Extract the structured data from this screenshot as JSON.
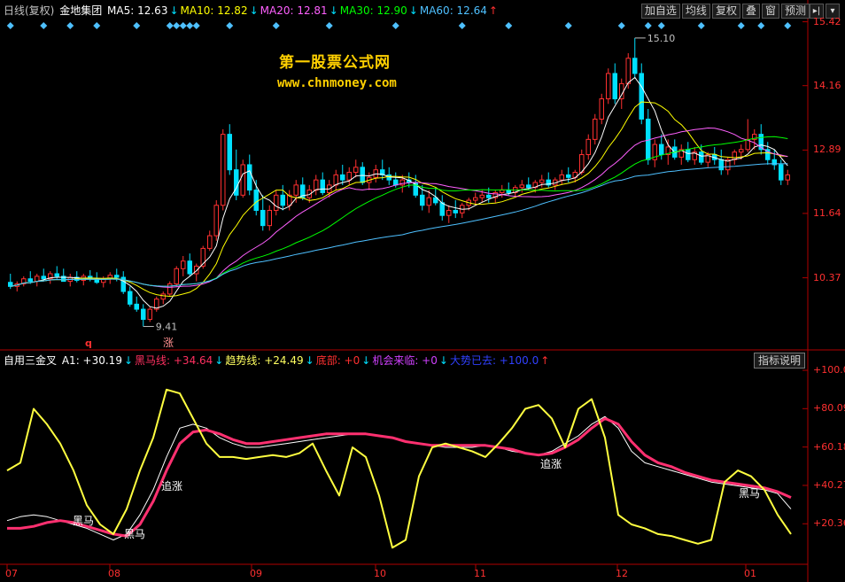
{
  "header": {
    "period": "日线(复权)",
    "stock_name": "金地集团",
    "ma": [
      {
        "label": "MA5:",
        "value": "12.63",
        "arrow": "↓",
        "color": "#ffffff"
      },
      {
        "label": "MA10:",
        "value": "12.82",
        "arrow": "↓",
        "color": "#ffff00"
      },
      {
        "label": "MA20:",
        "value": "12.81",
        "arrow": "↓",
        "color": "#ff60ff"
      },
      {
        "label": "MA30:",
        "value": "12.90",
        "arrow": "↓",
        "color": "#00ff00"
      },
      {
        "label": "MA60:",
        "value": "12.64",
        "arrow": "↑",
        "color": "#4ec0ff"
      }
    ]
  },
  "toolbar": {
    "buttons": [
      "加自选",
      "均线",
      "复权",
      "叠",
      "窗",
      "预测"
    ],
    "nav_icon": "collapse-arrow-icon",
    "dropdown_icon": "dropdown-icon"
  },
  "watermark": {
    "title": "第一股票公式网",
    "url": "www.chnmoney.com"
  },
  "indicator": {
    "name": "自用三金叉",
    "items": [
      {
        "label": "A1:",
        "value": "+30.19",
        "arrow": "↓",
        "color": "#ffffff"
      },
      {
        "label": "黑马线:",
        "value": "+34.64",
        "arrow": "↓",
        "color": "#ff3060"
      },
      {
        "label": "趋势线:",
        "value": "+24.49",
        "arrow": "↓",
        "color": "#ffff60"
      },
      {
        "label": "底部:",
        "value": "+0",
        "arrow": "↓",
        "color": "#ff3030"
      },
      {
        "label": "机会来临:",
        "value": "+0",
        "arrow": "↓",
        "color": "#d040ff"
      },
      {
        "label": "大势已去:",
        "value": "+100.0",
        "arrow": "↑",
        "color": "#3040ff"
      }
    ],
    "help_button": "指标说明"
  },
  "colors": {
    "up": "#ff3030",
    "down": "#00e0ff",
    "axis": "#b00000"
  },
  "chart_data": [
    {
      "type": "candlestick",
      "ylim": [
        9.0,
        15.5
      ],
      "y_ticks": [
        15.42,
        14.16,
        12.89,
        11.64,
        10.37
      ],
      "x_tick_labels": [
        "07",
        "08",
        "09",
        "10",
        "11",
        "12",
        "01"
      ],
      "annotations": [
        {
          "label": "15.10",
          "note": "period high"
        },
        {
          "label": "9.41",
          "note": "period low"
        }
      ],
      "markers": [
        "q",
        "涨"
      ],
      "ohlc": [
        {
          "o": 10.28,
          "h": 10.45,
          "l": 10.15,
          "c": 10.2
        },
        {
          "o": 10.2,
          "h": 10.3,
          "l": 10.1,
          "c": 10.25
        },
        {
          "o": 10.25,
          "h": 10.4,
          "l": 10.2,
          "c": 10.35
        },
        {
          "o": 10.35,
          "h": 10.5,
          "l": 10.25,
          "c": 10.3
        },
        {
          "o": 10.3,
          "h": 10.45,
          "l": 10.2,
          "c": 10.4
        },
        {
          "o": 10.4,
          "h": 10.55,
          "l": 10.3,
          "c": 10.35
        },
        {
          "o": 10.35,
          "h": 10.5,
          "l": 10.25,
          "c": 10.45
        },
        {
          "o": 10.45,
          "h": 10.6,
          "l": 10.35,
          "c": 10.4
        },
        {
          "o": 10.4,
          "h": 10.55,
          "l": 10.3,
          "c": 10.3
        },
        {
          "o": 10.3,
          "h": 10.45,
          "l": 10.2,
          "c": 10.38
        },
        {
          "o": 10.38,
          "h": 10.5,
          "l": 10.28,
          "c": 10.32
        },
        {
          "o": 10.32,
          "h": 10.45,
          "l": 10.22,
          "c": 10.4
        },
        {
          "o": 10.4,
          "h": 10.52,
          "l": 10.3,
          "c": 10.35
        },
        {
          "o": 10.35,
          "h": 10.48,
          "l": 10.25,
          "c": 10.28
        },
        {
          "o": 10.28,
          "h": 10.4,
          "l": 10.18,
          "c": 10.35
        },
        {
          "o": 10.35,
          "h": 10.48,
          "l": 10.25,
          "c": 10.42
        },
        {
          "o": 10.42,
          "h": 10.55,
          "l": 10.3,
          "c": 10.38
        },
        {
          "o": 10.38,
          "h": 10.5,
          "l": 10.05,
          "c": 10.1
        },
        {
          "o": 10.1,
          "h": 10.2,
          "l": 9.8,
          "c": 9.85
        },
        {
          "o": 9.85,
          "h": 10.0,
          "l": 9.7,
          "c": 9.75
        },
        {
          "o": 9.75,
          "h": 9.85,
          "l": 9.41,
          "c": 9.55
        },
        {
          "o": 9.55,
          "h": 9.8,
          "l": 9.5,
          "c": 9.75
        },
        {
          "o": 9.75,
          "h": 10.0,
          "l": 9.7,
          "c": 9.95
        },
        {
          "o": 9.95,
          "h": 10.1,
          "l": 9.85,
          "c": 10.05
        },
        {
          "o": 10.05,
          "h": 10.3,
          "l": 10.0,
          "c": 10.25
        },
        {
          "o": 10.25,
          "h": 10.6,
          "l": 10.2,
          "c": 10.55
        },
        {
          "o": 10.55,
          "h": 10.8,
          "l": 10.4,
          "c": 10.7
        },
        {
          "o": 10.7,
          "h": 10.85,
          "l": 10.4,
          "c": 10.45
        },
        {
          "o": 10.45,
          "h": 10.65,
          "l": 10.3,
          "c": 10.6
        },
        {
          "o": 10.6,
          "h": 11.0,
          "l": 10.55,
          "c": 10.95
        },
        {
          "o": 10.95,
          "h": 11.3,
          "l": 10.9,
          "c": 11.2
        },
        {
          "o": 11.2,
          "h": 11.9,
          "l": 11.1,
          "c": 11.8
        },
        {
          "o": 11.8,
          "h": 13.3,
          "l": 11.7,
          "c": 13.2
        },
        {
          "o": 13.2,
          "h": 13.4,
          "l": 12.4,
          "c": 12.5
        },
        {
          "o": 12.5,
          "h": 12.9,
          "l": 11.9,
          "c": 12.0
        },
        {
          "o": 12.0,
          "h": 12.7,
          "l": 11.95,
          "c": 12.6
        },
        {
          "o": 12.6,
          "h": 12.8,
          "l": 12.0,
          "c": 12.1
        },
        {
          "o": 12.1,
          "h": 12.3,
          "l": 11.6,
          "c": 11.7
        },
        {
          "o": 11.7,
          "h": 12.0,
          "l": 11.3,
          "c": 11.4
        },
        {
          "o": 11.4,
          "h": 11.8,
          "l": 11.3,
          "c": 11.7
        },
        {
          "o": 11.7,
          "h": 12.1,
          "l": 11.6,
          "c": 12.0
        },
        {
          "o": 12.0,
          "h": 12.2,
          "l": 11.7,
          "c": 11.8
        },
        {
          "o": 11.8,
          "h": 12.1,
          "l": 11.7,
          "c": 12.0
        },
        {
          "o": 12.0,
          "h": 12.3,
          "l": 11.85,
          "c": 12.2
        },
        {
          "o": 12.2,
          "h": 12.35,
          "l": 11.9,
          "c": 11.95
        },
        {
          "o": 11.95,
          "h": 12.2,
          "l": 11.85,
          "c": 12.1
        },
        {
          "o": 12.1,
          "h": 12.4,
          "l": 12.0,
          "c": 12.3
        },
        {
          "o": 12.3,
          "h": 12.45,
          "l": 12.0,
          "c": 12.05
        },
        {
          "o": 12.05,
          "h": 12.3,
          "l": 11.95,
          "c": 12.2
        },
        {
          "o": 12.2,
          "h": 12.5,
          "l": 12.1,
          "c": 12.4
        },
        {
          "o": 12.4,
          "h": 12.6,
          "l": 12.2,
          "c": 12.3
        },
        {
          "o": 12.3,
          "h": 12.55,
          "l": 12.2,
          "c": 12.45
        },
        {
          "o": 12.45,
          "h": 12.7,
          "l": 12.35,
          "c": 12.55
        },
        {
          "o": 12.55,
          "h": 12.65,
          "l": 12.2,
          "c": 12.25
        },
        {
          "o": 12.25,
          "h": 12.45,
          "l": 12.1,
          "c": 12.35
        },
        {
          "o": 12.35,
          "h": 12.6,
          "l": 12.25,
          "c": 12.5
        },
        {
          "o": 12.5,
          "h": 12.7,
          "l": 12.3,
          "c": 12.4
        },
        {
          "o": 12.4,
          "h": 12.55,
          "l": 12.2,
          "c": 12.3
        },
        {
          "o": 12.3,
          "h": 12.45,
          "l": 12.15,
          "c": 12.2
        },
        {
          "o": 12.2,
          "h": 12.4,
          "l": 12.05,
          "c": 12.3
        },
        {
          "o": 12.3,
          "h": 12.45,
          "l": 12.15,
          "c": 12.25
        },
        {
          "o": 12.25,
          "h": 12.4,
          "l": 11.95,
          "c": 12.0
        },
        {
          "o": 12.0,
          "h": 12.2,
          "l": 11.7,
          "c": 11.8
        },
        {
          "o": 11.8,
          "h": 12.1,
          "l": 11.65,
          "c": 11.95
        },
        {
          "o": 11.95,
          "h": 12.15,
          "l": 11.8,
          "c": 11.85
        },
        {
          "o": 11.85,
          "h": 12.0,
          "l": 11.5,
          "c": 11.6
        },
        {
          "o": 11.6,
          "h": 11.8,
          "l": 11.45,
          "c": 11.7
        },
        {
          "o": 11.7,
          "h": 11.9,
          "l": 11.55,
          "c": 11.65
        },
        {
          "o": 11.65,
          "h": 11.85,
          "l": 11.55,
          "c": 11.8
        },
        {
          "o": 11.8,
          "h": 11.95,
          "l": 11.7,
          "c": 11.9
        },
        {
          "o": 11.9,
          "h": 12.05,
          "l": 11.8,
          "c": 11.95
        },
        {
          "o": 11.95,
          "h": 12.1,
          "l": 11.85,
          "c": 12.0
        },
        {
          "o": 12.0,
          "h": 12.15,
          "l": 11.85,
          "c": 11.95
        },
        {
          "o": 11.95,
          "h": 12.1,
          "l": 11.85,
          "c": 12.05
        },
        {
          "o": 12.05,
          "h": 12.2,
          "l": 11.95,
          "c": 12.1
        },
        {
          "o": 12.1,
          "h": 12.25,
          "l": 12.0,
          "c": 12.05
        },
        {
          "o": 12.05,
          "h": 12.2,
          "l": 11.95,
          "c": 12.15
        },
        {
          "o": 12.15,
          "h": 12.3,
          "l": 12.05,
          "c": 12.2
        },
        {
          "o": 12.2,
          "h": 12.35,
          "l": 12.1,
          "c": 12.15
        },
        {
          "o": 12.15,
          "h": 12.3,
          "l": 12.05,
          "c": 12.25
        },
        {
          "o": 12.25,
          "h": 12.4,
          "l": 12.15,
          "c": 12.3
        },
        {
          "o": 12.3,
          "h": 12.45,
          "l": 12.15,
          "c": 12.2
        },
        {
          "o": 12.2,
          "h": 12.35,
          "l": 12.1,
          "c": 12.3
        },
        {
          "o": 12.3,
          "h": 12.5,
          "l": 12.2,
          "c": 12.4
        },
        {
          "o": 12.4,
          "h": 12.55,
          "l": 12.25,
          "c": 12.35
        },
        {
          "o": 12.35,
          "h": 12.5,
          "l": 12.25,
          "c": 12.45
        },
        {
          "o": 12.45,
          "h": 12.9,
          "l": 12.4,
          "c": 12.8
        },
        {
          "o": 12.8,
          "h": 13.2,
          "l": 12.7,
          "c": 13.1
        },
        {
          "o": 13.1,
          "h": 13.6,
          "l": 13.0,
          "c": 13.5
        },
        {
          "o": 13.5,
          "h": 14.0,
          "l": 13.4,
          "c": 13.9
        },
        {
          "o": 13.9,
          "h": 14.5,
          "l": 13.8,
          "c": 14.4
        },
        {
          "o": 14.4,
          "h": 14.6,
          "l": 13.8,
          "c": 13.9
        },
        {
          "o": 13.9,
          "h": 14.3,
          "l": 13.7,
          "c": 14.2
        },
        {
          "o": 14.2,
          "h": 14.8,
          "l": 14.1,
          "c": 14.7
        },
        {
          "o": 14.7,
          "h": 15.1,
          "l": 14.3,
          "c": 14.4
        },
        {
          "o": 14.4,
          "h": 14.6,
          "l": 13.4,
          "c": 13.5
        },
        {
          "o": 13.5,
          "h": 13.7,
          "l": 12.6,
          "c": 12.7
        },
        {
          "o": 12.7,
          "h": 13.1,
          "l": 12.55,
          "c": 13.0
        },
        {
          "o": 13.0,
          "h": 13.2,
          "l": 12.7,
          "c": 12.8
        },
        {
          "o": 12.8,
          "h": 13.1,
          "l": 12.6,
          "c": 12.95
        },
        {
          "o": 12.95,
          "h": 13.1,
          "l": 12.7,
          "c": 12.75
        },
        {
          "o": 12.75,
          "h": 13.0,
          "l": 12.6,
          "c": 12.9
        },
        {
          "o": 12.9,
          "h": 13.05,
          "l": 12.65,
          "c": 12.7
        },
        {
          "o": 12.7,
          "h": 12.95,
          "l": 12.6,
          "c": 12.85
        },
        {
          "o": 12.85,
          "h": 13.0,
          "l": 12.6,
          "c": 12.65
        },
        {
          "o": 12.65,
          "h": 12.85,
          "l": 12.55,
          "c": 12.8
        },
        {
          "o": 12.8,
          "h": 12.95,
          "l": 12.6,
          "c": 12.7
        },
        {
          "o": 12.7,
          "h": 12.9,
          "l": 12.4,
          "c": 12.5
        },
        {
          "o": 12.5,
          "h": 12.75,
          "l": 12.4,
          "c": 12.7
        },
        {
          "o": 12.7,
          "h": 12.9,
          "l": 12.6,
          "c": 12.85
        },
        {
          "o": 12.85,
          "h": 13.0,
          "l": 12.7,
          "c": 12.9
        },
        {
          "o": 12.9,
          "h": 13.5,
          "l": 12.85,
          "c": 13.1
        },
        {
          "o": 13.1,
          "h": 13.3,
          "l": 12.9,
          "c": 13.2
        },
        {
          "o": 13.2,
          "h": 13.4,
          "l": 12.8,
          "c": 12.9
        },
        {
          "o": 12.9,
          "h": 13.05,
          "l": 12.6,
          "c": 12.7
        },
        {
          "o": 12.7,
          "h": 12.9,
          "l": 12.5,
          "c": 12.6
        },
        {
          "o": 12.6,
          "h": 12.7,
          "l": 12.2,
          "c": 12.3
        },
        {
          "o": 12.3,
          "h": 12.5,
          "l": 12.2,
          "c": 12.4
        }
      ]
    },
    {
      "type": "line",
      "ylim": [
        0,
        100
      ],
      "y_ticks": [
        "+100.0",
        "+80.09",
        "+60.18",
        "+40.27",
        "+20.36"
      ],
      "x_tick_labels": [
        "07",
        "08",
        "09",
        "10",
        "11",
        "12",
        "01"
      ],
      "series": [
        {
          "name": "A1",
          "color": "#ffffff",
          "values": [
            22,
            24,
            25,
            24,
            22,
            20,
            18,
            15,
            12,
            15,
            25,
            38,
            55,
            70,
            72,
            70,
            65,
            62,
            60,
            60,
            61,
            62,
            63,
            64,
            65,
            66,
            67,
            67,
            66,
            65,
            63,
            62,
            61,
            60,
            60,
            60,
            61,
            60,
            58,
            57,
            56,
            58,
            62,
            66,
            72,
            76,
            70,
            58,
            52,
            50,
            48,
            46,
            44,
            42,
            41,
            40,
            39,
            38,
            36,
            28
          ]
        },
        {
          "name": "黑马线",
          "color": "#ff3070",
          "values": [
            18,
            18,
            19,
            21,
            22,
            21,
            19,
            17,
            15,
            14,
            20,
            32,
            48,
            62,
            68,
            69,
            67,
            64,
            62,
            62,
            63,
            64,
            65,
            66,
            67,
            67,
            67,
            67,
            66,
            65,
            63,
            62,
            61,
            61,
            61,
            61,
            61,
            60,
            59,
            57,
            56,
            57,
            60,
            64,
            70,
            75,
            72,
            63,
            56,
            52,
            50,
            47,
            45,
            43,
            42,
            41,
            40,
            39,
            37,
            34
          ]
        },
        {
          "name": "趋势线",
          "color": "#ffff40",
          "values": [
            48,
            52,
            80,
            72,
            62,
            48,
            30,
            20,
            15,
            28,
            48,
            65,
            90,
            88,
            75,
            62,
            55,
            55,
            54,
            55,
            56,
            55,
            57,
            62,
            48,
            35,
            60,
            55,
            35,
            8,
            12,
            45,
            60,
            62,
            60,
            58,
            55,
            62,
            70,
            80,
            82,
            75,
            60,
            80,
            85,
            65,
            25,
            20,
            18,
            15,
            14,
            12,
            10,
            12,
            42,
            48,
            45,
            38,
            25,
            15
          ]
        }
      ],
      "labels": [
        "黑马",
        "黑马",
        "追涨",
        "追涨",
        "黑马"
      ]
    }
  ]
}
